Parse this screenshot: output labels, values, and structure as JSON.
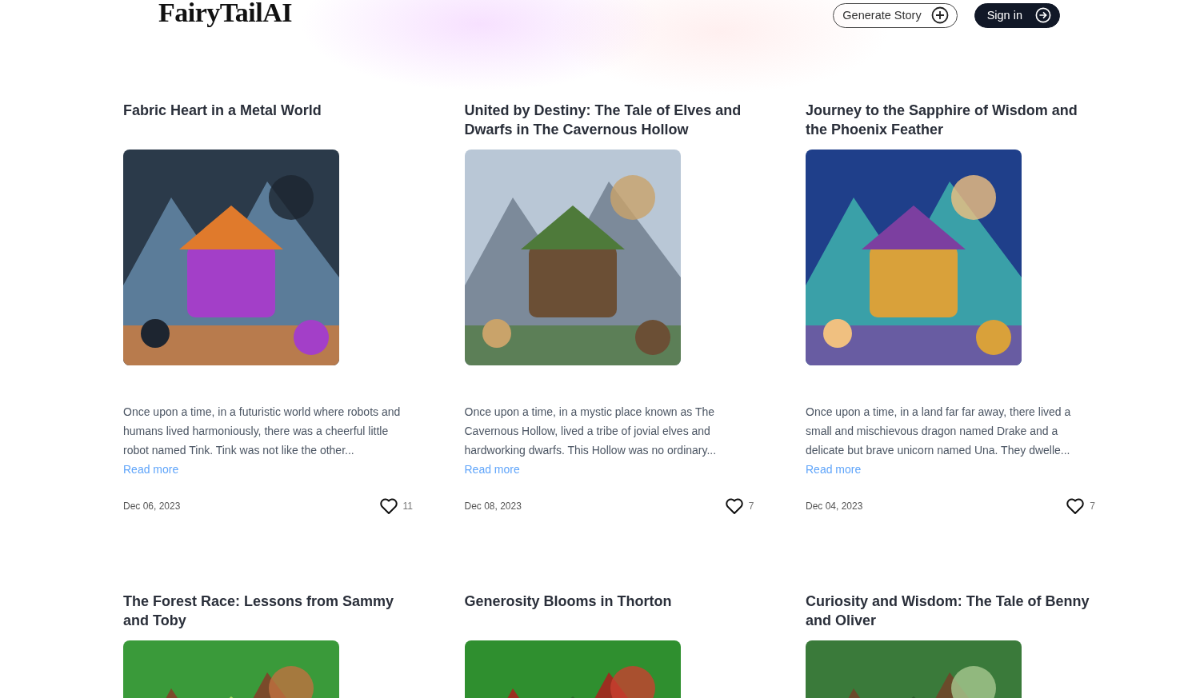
{
  "header": {
    "logo": "FairyTailAI",
    "generate_button": "Generate Story",
    "sign_in_button": "Sign in"
  },
  "stories": [
    {
      "title": "Fabric Heart in a Metal World",
      "excerpt": "Once upon a time, in a futuristic world where robots and humans lived harmoniously, there was a cheerful little robot named Tink. Tink was not like the other...",
      "read_more": "Read more",
      "date": "Dec 06, 2023",
      "likes": "11"
    },
    {
      "title": "United by Destiny: The Tale of Elves and Dwarfs in The Cavernous Hollow",
      "excerpt": "Once upon a time, in a mystic place known as The Cavernous Hollow, lived a tribe of jovial elves and hardworking dwarfs. This Hollow was no ordinary...",
      "read_more": "Read more",
      "date": "Dec 08, 2023",
      "likes": "7"
    },
    {
      "title": "Journey to the Sapphire of Wisdom and the Phoenix Feather",
      "excerpt": "Once upon a time, in a land far far away, there lived a small and mischievous dragon named Drake and a delicate but brave unicorn named Una. They dwelle...",
      "read_more": "Read more",
      "date": "Dec 04, 2023",
      "likes": "7"
    },
    {
      "title": "The Forest Race: Lessons from Sammy and Toby"
    },
    {
      "title": "Generosity Blooms in Thorton"
    },
    {
      "title": "Curiosity and Wisdom: The Tale of Benny and Oliver"
    }
  ]
}
